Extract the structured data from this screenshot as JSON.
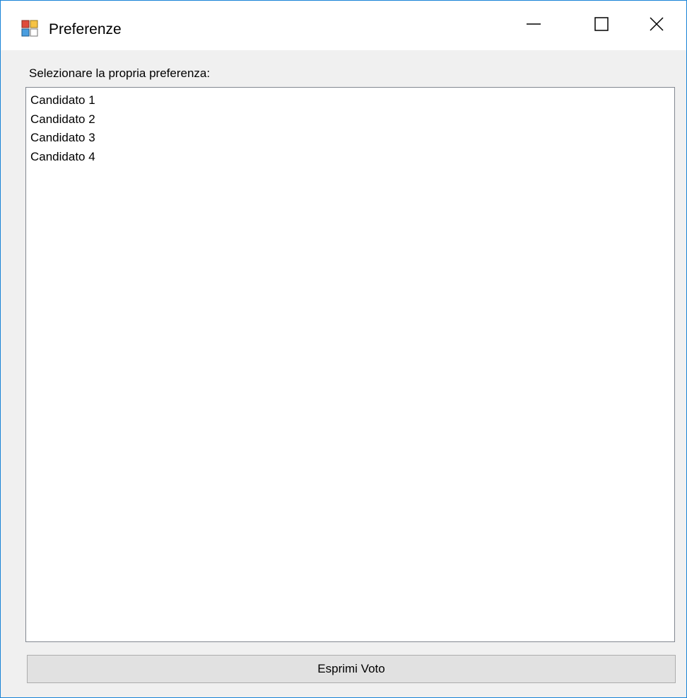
{
  "window": {
    "title": "Preferenze",
    "icon": "windows-form-icon",
    "accent_border": "#1883d7"
  },
  "titlebar_controls": {
    "minimize_icon": "minimize-icon",
    "maximize_icon": "maximize-icon",
    "close_icon": "close-icon"
  },
  "form": {
    "prompt_label": "Selezionare la propria preferenza:",
    "candidates": [
      "Candidato 1",
      "Candidato 2",
      "Candidato 3",
      "Candidato 4"
    ],
    "submit_label": "Esprimi Voto"
  }
}
